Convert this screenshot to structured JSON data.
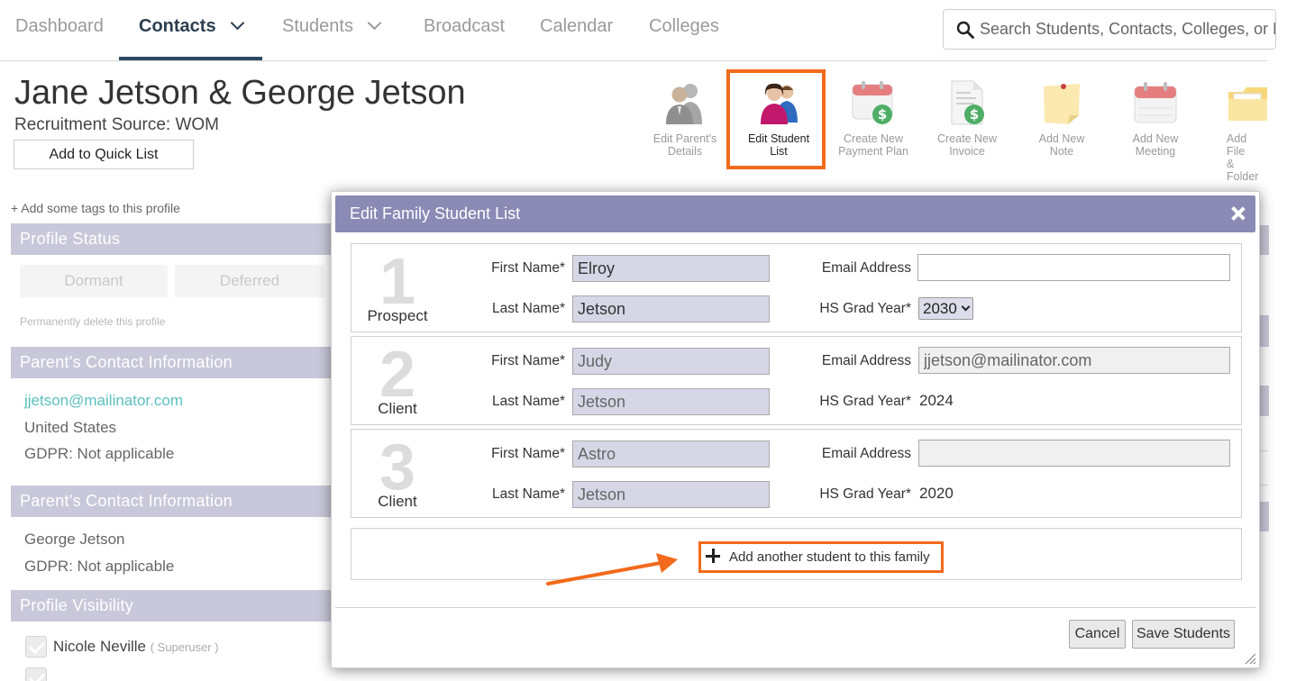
{
  "nav": {
    "items": [
      {
        "label": "Dashboard"
      },
      {
        "label": "Contacts"
      },
      {
        "label": "Students"
      },
      {
        "label": "Broadcast"
      },
      {
        "label": "Calendar"
      },
      {
        "label": "Colleges"
      }
    ],
    "active": "Contacts",
    "search_placeholder": "Search Students, Contacts, Colleges, or No"
  },
  "header": {
    "name": "Jane Jetson & George Jetson",
    "recruitment_source": "Recruitment Source: WOM",
    "quick_list_label": "Add to Quick List"
  },
  "toolbar": [
    {
      "line1": "Edit Parent's",
      "line2": "Details",
      "icon": "parents-icon"
    },
    {
      "line1": "Edit Student",
      "line2": "List",
      "icon": "student-list-icon"
    },
    {
      "line1": "Create New",
      "line2": "Payment Plan",
      "icon": "payment-plan-icon"
    },
    {
      "line1": "Create New",
      "line2": "Invoice",
      "icon": "invoice-icon"
    },
    {
      "line1": "Add New",
      "line2": "Note",
      "icon": "note-icon"
    },
    {
      "line1": "Add New",
      "line2": "Meeting",
      "icon": "meeting-icon"
    },
    {
      "line1": "Add File",
      "line2": "& Folder",
      "icon": "folder-icon"
    }
  ],
  "sidebar": {
    "tags_link": "+ Add some tags to this profile",
    "profile_status": {
      "title": "Profile Status",
      "buttons": [
        "Dormant",
        "Deferred"
      ],
      "delete_link": "Permanently delete this profile"
    },
    "parent1": {
      "title": "Parent's Contact Information",
      "email": "jjetson@mailinator.com",
      "country": "United States",
      "gdpr": "GDPR:  Not applicable"
    },
    "parent2": {
      "title": "Parent's Contact Information",
      "name": "George Jetson",
      "gdpr": "GDPR:  Not applicable"
    },
    "visibility": {
      "title": "Profile Visibility",
      "user": "Nicole Neville",
      "role": "( Superuser )"
    }
  },
  "modal": {
    "title": "Edit Family Student List",
    "labels": {
      "first_name": "First Name*",
      "last_name": "Last Name*",
      "email": "Email Address",
      "grad_year": "HS Grad Year*"
    },
    "students": [
      {
        "number": "1",
        "status": "Prospect",
        "first_name": "Elroy",
        "last_name": "Jetson",
        "email": "",
        "grad_year": "2030",
        "grad_year_editable": true
      },
      {
        "number": "2",
        "status": "Client",
        "first_name": "Judy",
        "last_name": "Jetson",
        "email": "jjetson@mailinator.com",
        "grad_year": "2024",
        "grad_year_editable": false
      },
      {
        "number": "3",
        "status": "Client",
        "first_name": "Astro",
        "last_name": "Jetson",
        "email": "",
        "grad_year": "2020",
        "grad_year_editable": false
      }
    ],
    "add_student_label": "Add another student to this family",
    "cancel_label": "Cancel",
    "save_label": "Save Students"
  },
  "colors": {
    "accent_orange": "#f26a1b",
    "modal_header": "#8a8ab5",
    "sidebar_header": "#c8c8da",
    "link_teal": "#5bbfc0"
  }
}
